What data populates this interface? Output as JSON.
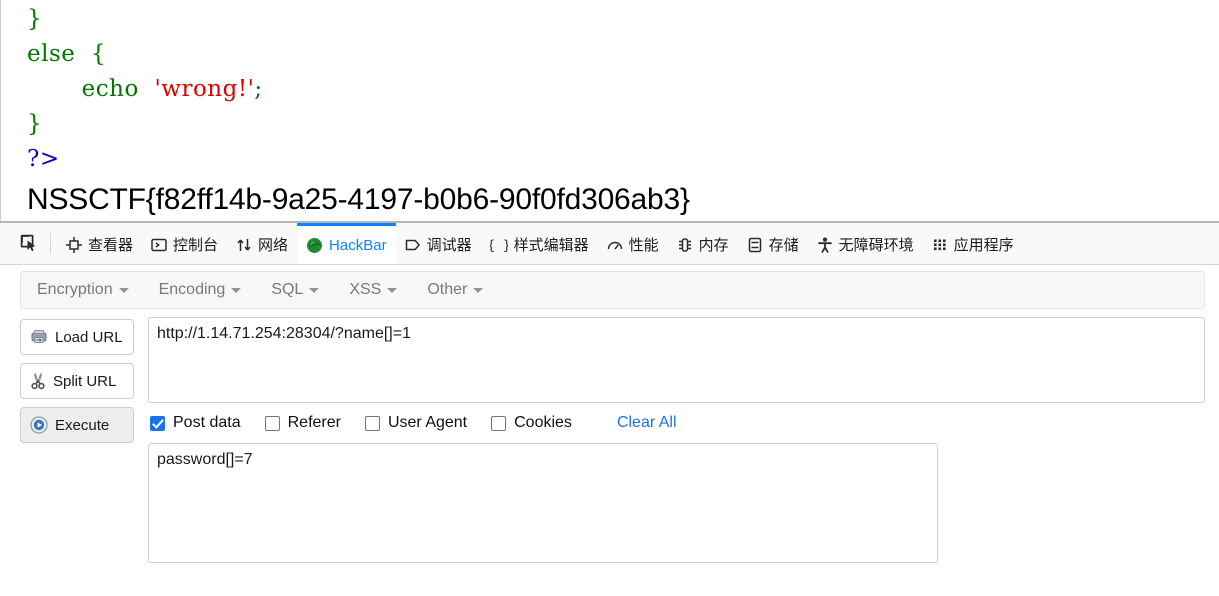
{
  "page": {
    "code_lines": [
      {
        "segments": [
          {
            "text": "}",
            "color": "green"
          }
        ]
      },
      {
        "segments": [
          {
            "text": "else  {",
            "color": "green"
          }
        ]
      },
      {
        "segments": [
          {
            "text": "       echo  ",
            "color": "green"
          },
          {
            "text": "'wrong!'",
            "color": "red"
          },
          {
            "text": ";",
            "color": "green"
          }
        ]
      },
      {
        "segments": [
          {
            "text": "}",
            "color": "green"
          }
        ]
      },
      {
        "segments": [
          {
            "text": "?>",
            "color": "blue"
          }
        ]
      }
    ],
    "flag": "NSSCTF{f82ff14b-9a25-4197-b0b6-90f0fd306ab3}"
  },
  "devtools": {
    "inspect_icon": "pick-element-icon",
    "tabs": [
      {
        "label": "查看器",
        "icon": "inspector-icon",
        "selected": false
      },
      {
        "label": "控制台",
        "icon": "console-icon",
        "selected": false
      },
      {
        "label": "网络",
        "icon": "network-icon",
        "selected": false
      },
      {
        "label": "HackBar",
        "icon": "hackbar-firefox-icon",
        "selected": true
      },
      {
        "label": "调试器",
        "icon": "debugger-icon",
        "selected": false
      },
      {
        "label": "样式编辑器",
        "icon": "style-editor-icon",
        "selected": false
      },
      {
        "label": "性能",
        "icon": "performance-icon",
        "selected": false
      },
      {
        "label": "内存",
        "icon": "memory-icon",
        "selected": false
      },
      {
        "label": "存储",
        "icon": "storage-icon",
        "selected": false
      },
      {
        "label": "无障碍环境",
        "icon": "accessibility-icon",
        "selected": false
      },
      {
        "label": "应用程序",
        "icon": "application-icon",
        "selected": false
      }
    ]
  },
  "hackbar": {
    "menu": [
      {
        "label": "Encryption"
      },
      {
        "label": "Encoding"
      },
      {
        "label": "SQL"
      },
      {
        "label": "XSS"
      },
      {
        "label": "Other"
      }
    ],
    "buttons": [
      {
        "label": "Load URL",
        "icon": "load-url-icon",
        "primary": false
      },
      {
        "label": "Split URL",
        "icon": "split-url-icon",
        "primary": false
      },
      {
        "label": "Execute",
        "icon": "execute-play-icon",
        "primary": true
      }
    ],
    "url_value": "http://1.14.71.254:28304/?name[]=1",
    "url_placeholder": "",
    "checkboxes": [
      {
        "label": "Post data",
        "checked": true
      },
      {
        "label": "Referer",
        "checked": false
      },
      {
        "label": "User Agent",
        "checked": false
      },
      {
        "label": "Cookies",
        "checked": false
      }
    ],
    "clear_all_label": "Clear All",
    "post_data_value": "password[]=7",
    "post_data_placeholder": ""
  },
  "colors": {
    "accent": "#0a84ff",
    "link": "#1a73e8",
    "code_green": "#007700",
    "code_red": "#dd0000",
    "code_blue": "#0000bb"
  }
}
